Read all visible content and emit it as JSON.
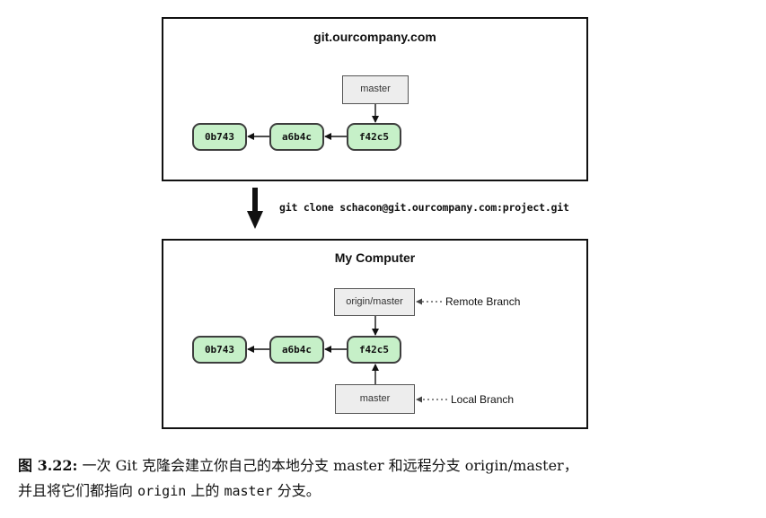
{
  "server": {
    "title": "git.ourcompany.com",
    "branch": "master",
    "commits": [
      "0b743",
      "a6b4c",
      "f42c5"
    ]
  },
  "command": "git clone schacon@git.ourcompany.com:project.git",
  "local": {
    "title": "My Computer",
    "remote_branch": "origin/master",
    "remote_branch_label": "Remote Branch",
    "local_branch": "master",
    "local_branch_label": "Local Branch",
    "commits": [
      "0b743",
      "a6b4c",
      "f42c5"
    ]
  },
  "caption": {
    "label": "图 3.22:",
    "text_part1": " 一次 Git 克隆会建立你自己的本地分支 master 和远程分支 origin/master，",
    "text_part2": "并且将它们都指向 ",
    "code1": "origin",
    "text_part3": " 上的 ",
    "code2": "master",
    "text_part4": " 分支。"
  },
  "colors": {
    "commit_fill": "#c6f0c8",
    "branch_fill": "#ededed"
  }
}
